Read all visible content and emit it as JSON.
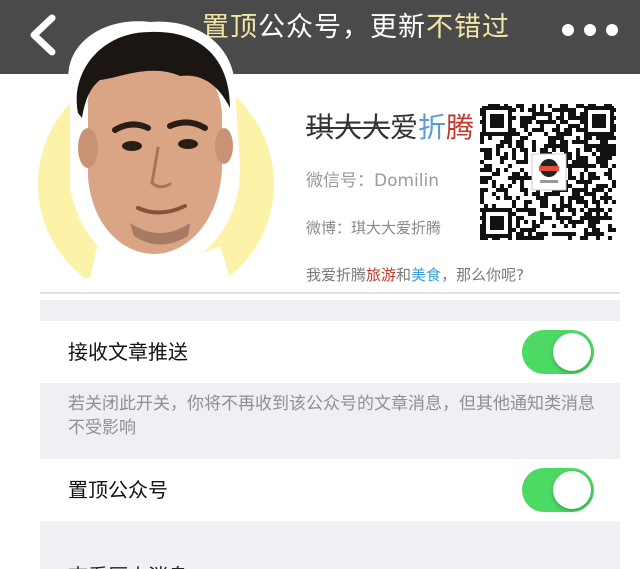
{
  "header": {
    "title_part1": "置顶",
    "title_part2": "公众号，更新",
    "title_part3": "不错过",
    "back_icon": "chevron-left-icon",
    "more_icon": "more-dots-icon"
  },
  "profile": {
    "name_strike": "琪大大",
    "name_mid": "爱",
    "name_blue": "折",
    "name_red": "腾",
    "wechat_id": "微信号：Domilin",
    "weibo": "微博：琪大大爱折腾",
    "bio_prefix": "我爱折腾",
    "bio_travel": "旅游",
    "bio_and": "和",
    "bio_food": "美食",
    "bio_suffix": "，那么你呢?"
  },
  "settings": {
    "receive_push_label": "接收文章推送",
    "receive_push_on": true,
    "receive_push_note": "若关闭此开关，你将不再收到该公众号的文章消息，但其他通知类消息不受影响",
    "pin_label": "置顶公众号",
    "pin_on": true,
    "next_row_partial": "查看历史消息"
  },
  "colors": {
    "header_bg": "#4a4a4a",
    "title_highlight": "#f2e6a6",
    "toggle_on": "#4cd964",
    "avatar_circle": "#fdf3a8",
    "settings_bg": "#efeff4"
  }
}
